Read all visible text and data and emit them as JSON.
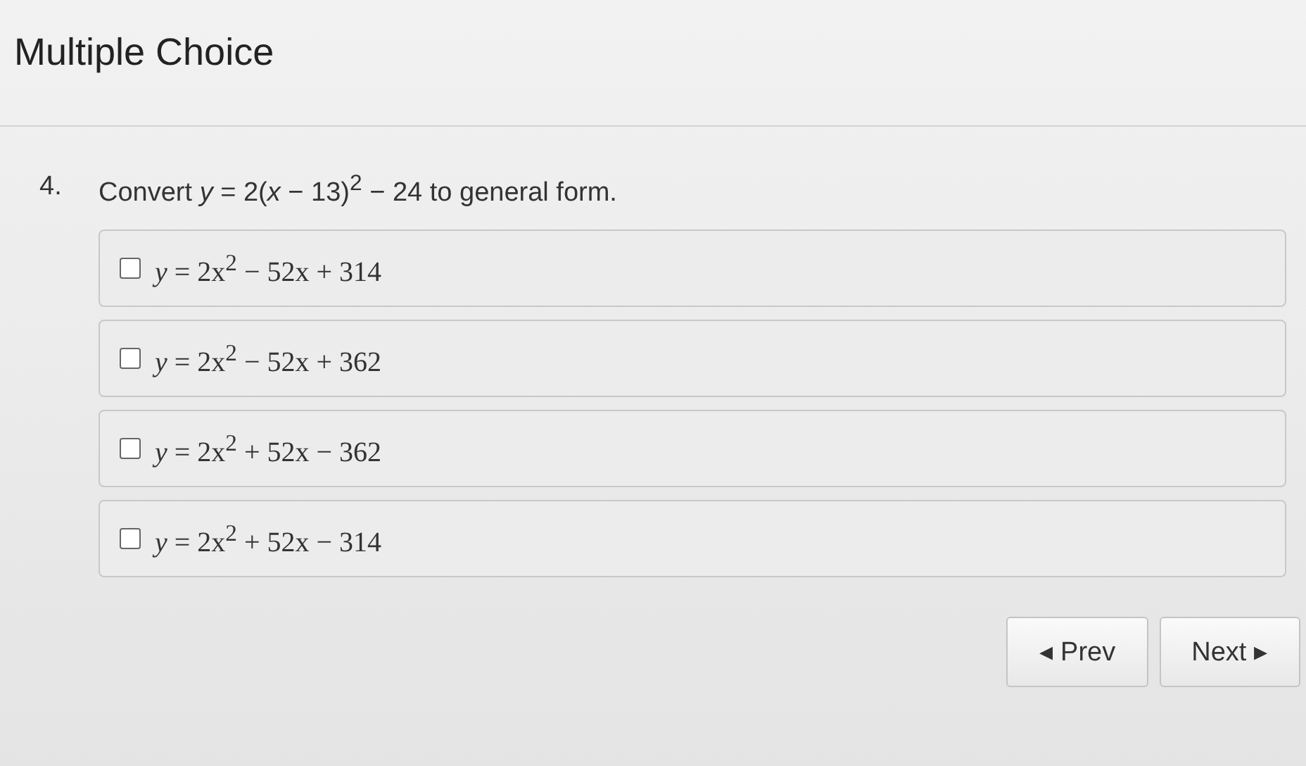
{
  "header": {
    "title": "Multiple Choice"
  },
  "question": {
    "number": "4.",
    "text": "Convert *y* = 2(*x* − 13)$^{2}$ − 24 to general form."
  },
  "options": [
    {
      "text": "*y* = 2x$^{2}$ − 52x + 314",
      "checked": false
    },
    {
      "text": "*y* = 2x$^{2}$ − 52x + 362",
      "checked": false
    },
    {
      "text": "*y* = 2x$^{2}$ + 52x − 362",
      "checked": false
    },
    {
      "text": "*y* = 2x$^{2}$ + 52x − 314",
      "checked": false
    }
  ],
  "navigation": {
    "prev": "◂ Prev",
    "next": "Next ▸"
  }
}
